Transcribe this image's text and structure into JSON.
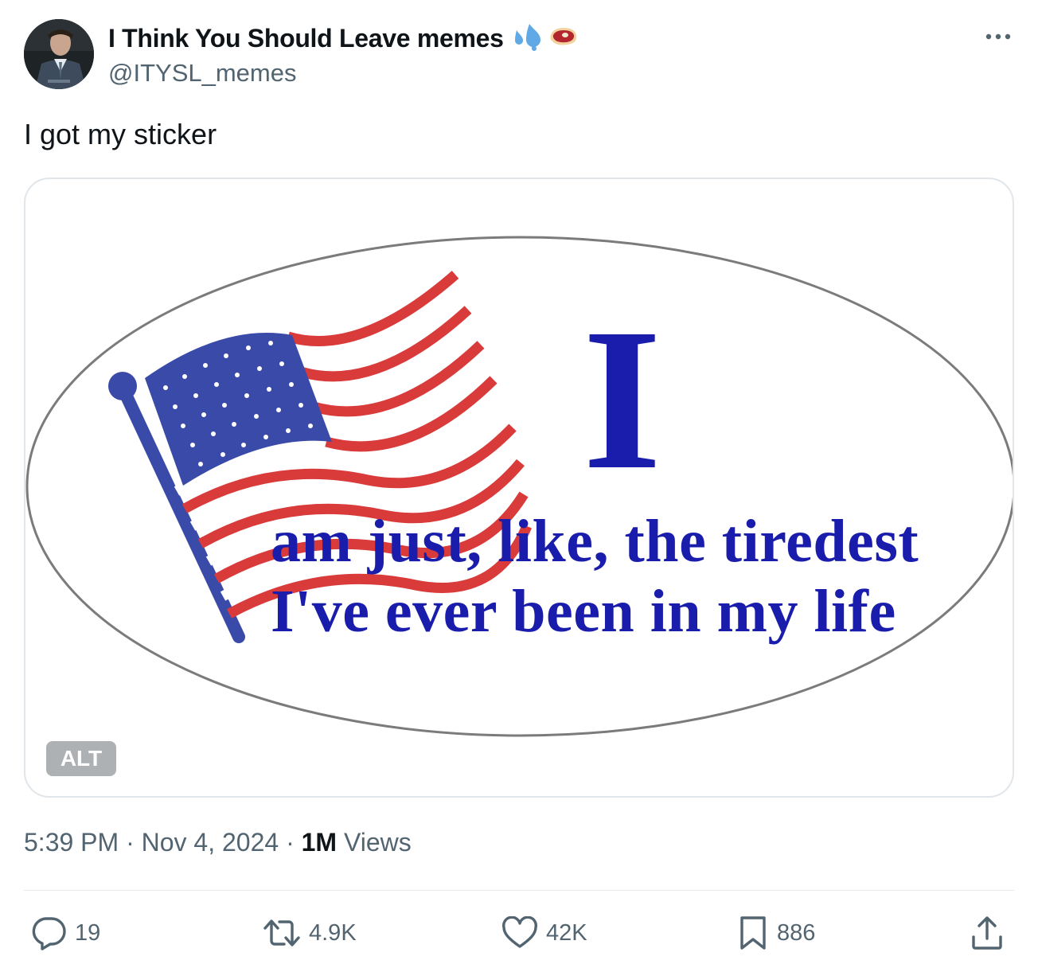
{
  "post": {
    "author": {
      "display_name": "I Think You Should Leave memes",
      "handle": "@ITYSL_memes",
      "avatar_icon": "avatar-photo"
    },
    "text": "I got my sticker",
    "media": {
      "sticker_headline": "I",
      "sticker_line1": "am just, like, the tiredest",
      "sticker_line2": "I've ever been in my life",
      "alt_label": "ALT",
      "colors": {
        "text_blue": "#1a1dab",
        "stripe_red": "#d93a3a",
        "canton_blue": "#3a4aa8"
      }
    },
    "time": "5:39 PM",
    "separator": "·",
    "date": "Nov 4, 2024",
    "views_count": "1M",
    "views_label": "Views",
    "stats": {
      "replies": "19",
      "reposts": "4.9K",
      "likes": "42K",
      "bookmarks": "886"
    }
  }
}
